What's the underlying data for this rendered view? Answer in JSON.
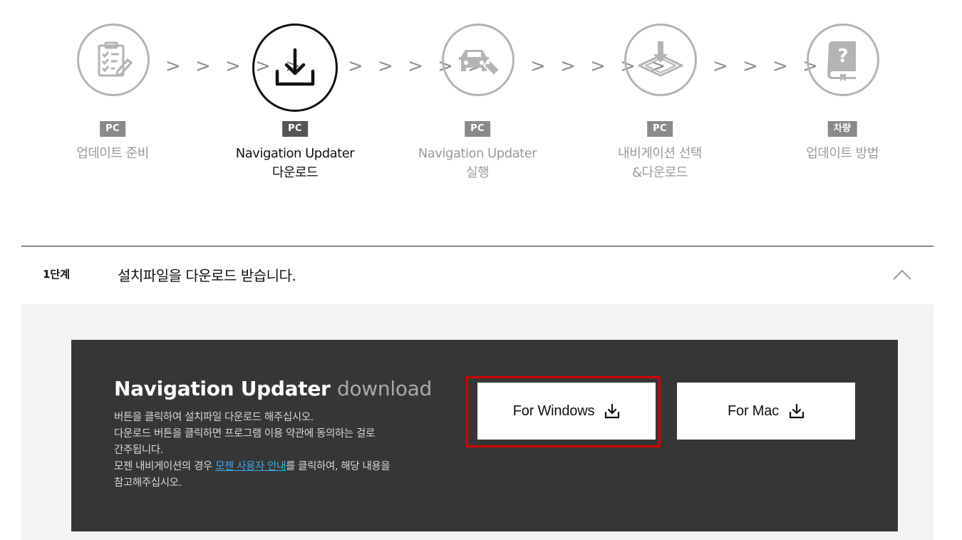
{
  "steps": [
    {
      "badge": "PC",
      "label_line1": "업데이트 준비",
      "label_line2": "",
      "icon": "clipboard-checklist-icon"
    },
    {
      "badge": "PC",
      "label_line1": "Navigation Updater",
      "label_line2": "다운로드",
      "icon": "download-icon"
    },
    {
      "badge": "PC",
      "label_line1": "Navigation Updater",
      "label_line2": "실행",
      "icon": "car-usb-icon"
    },
    {
      "badge": "PC",
      "label_line1": "내비게이션 선택",
      "label_line2": "&다운로드",
      "icon": "map-download-icon"
    },
    {
      "badge": "차량",
      "label_line1": "업데이트 방법",
      "label_line2": "",
      "icon": "help-book-icon"
    }
  ],
  "active_step": 2,
  "separator": "> > > > >",
  "section": {
    "step_number": "1단계",
    "title": "설치파일을 다운로드 받습니다."
  },
  "download": {
    "title_bold": "Navigation Updater",
    "title_light": "download",
    "desc_line1": "버튼을 클릭하여 설치파일 다운로드 해주십시오.",
    "desc_line2": "다운로드 버튼을 클릭하면 프로그램 이용 약관에 동의하는 걸로",
    "desc_line3": "간주됩니다.",
    "desc_line4_before": "모젠 내비게이션의 경우 ",
    "desc_link": "모젠 사용자 안내",
    "desc_line4_after": "를 클릭하여, 해당 내용을",
    "desc_line5": "참고해주십시오.",
    "windows_label": "For Windows",
    "mac_label": "For Mac"
  },
  "colors": {
    "dark_panel": "#363636",
    "highlight": "#d40000",
    "link": "#3da7e8",
    "inactive_gray": "#9b9b9b"
  }
}
